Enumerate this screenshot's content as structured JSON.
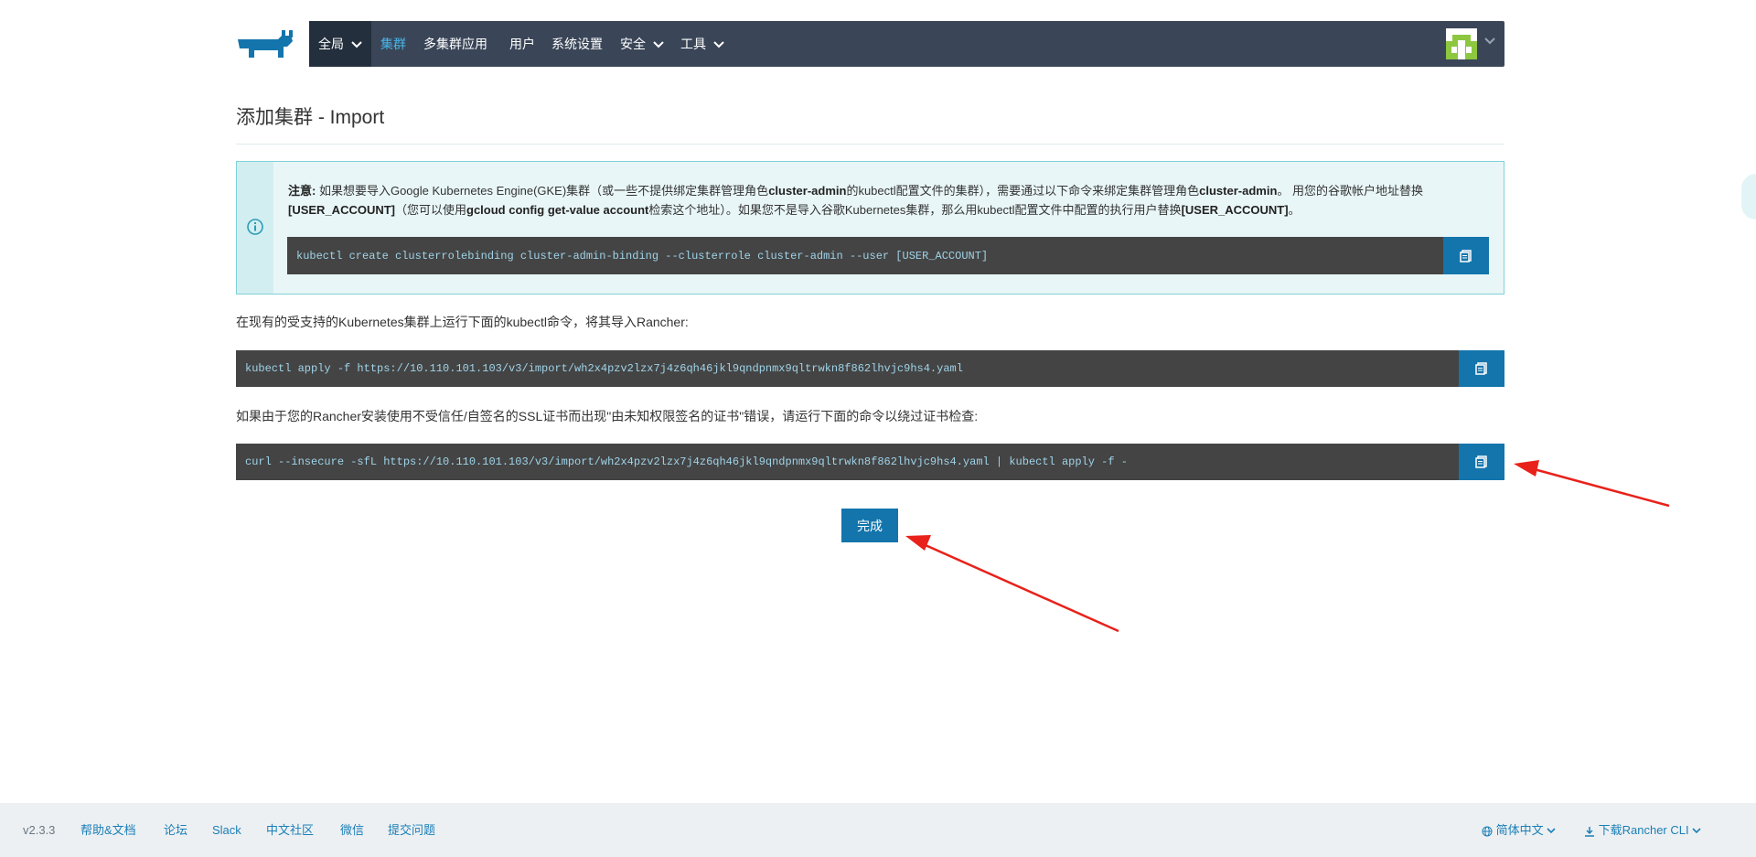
{
  "nav": {
    "global_label": "全局",
    "items": [
      {
        "label": "集群",
        "active": true
      },
      {
        "label": "多集群应用"
      },
      {
        "label": "用户"
      },
      {
        "label": "系统设置"
      },
      {
        "label": "安全"
      },
      {
        "label": "工具"
      }
    ]
  },
  "page": {
    "title": "添加集群 - Import"
  },
  "notice": {
    "label": "注意:",
    "text1": " 如果想要导入Google Kubernetes Engine(GKE)集群（或一些不提供绑定集群管理角色",
    "bold1": "cluster-admin",
    "text2": "的kubectl配置文件的集群），需要通过以下命令来绑定集群管理角色",
    "bold2": "cluster-admin",
    "text3": "。 用您的谷歌帐户地址替换",
    "bold3": "[USER_ACCOUNT]",
    "text4": "（您可以使用",
    "bold4": "gcloud config get-value account",
    "text5": "检索这个地址）。如果您不是导入谷歌Kubernetes集群，那么用kubectl配置文件中配置的执行用户替换",
    "bold5": "[USER_ACCOUNT]",
    "text6": "。",
    "command": "kubectl create clusterrolebinding cluster-admin-binding --clusterrole cluster-admin --user [USER_ACCOUNT]"
  },
  "step1": {
    "text": "在现有的受支持的Kubernetes集群上运行下面的kubectl命令，将其导入Rancher:",
    "command": "kubectl apply -f https://10.110.101.103/v3/import/wh2x4pzv2lzx7j4z6qh46jkl9qndpnmx9qltrwkn8f862lhvjc9hs4.yaml"
  },
  "step2": {
    "text": "如果由于您的Rancher安装使用不受信任/自签名的SSL证书而出现\"由未知权限签名的证书\"错误，请运行下面的命令以绕过证书检查:",
    "command": "curl --insecure -sfL https://10.110.101.103/v3/import/wh2x4pzv2lzx7j4z6qh46jkl9qndpnmx9qltrwkn8f862lhvjc9hs4.yaml | kubectl apply -f -"
  },
  "done_label": "完成",
  "footer": {
    "version": "v2.3.3",
    "links": [
      "帮助&文档",
      "论坛",
      "Slack",
      "中文社区",
      "微信",
      "提交问题"
    ],
    "language": "简体中文",
    "download": "下载Rancher CLI"
  },
  "colors": {
    "navbar": "#3a4658",
    "accent": "#1375ac",
    "annotation_arrow": "#e8221a"
  }
}
